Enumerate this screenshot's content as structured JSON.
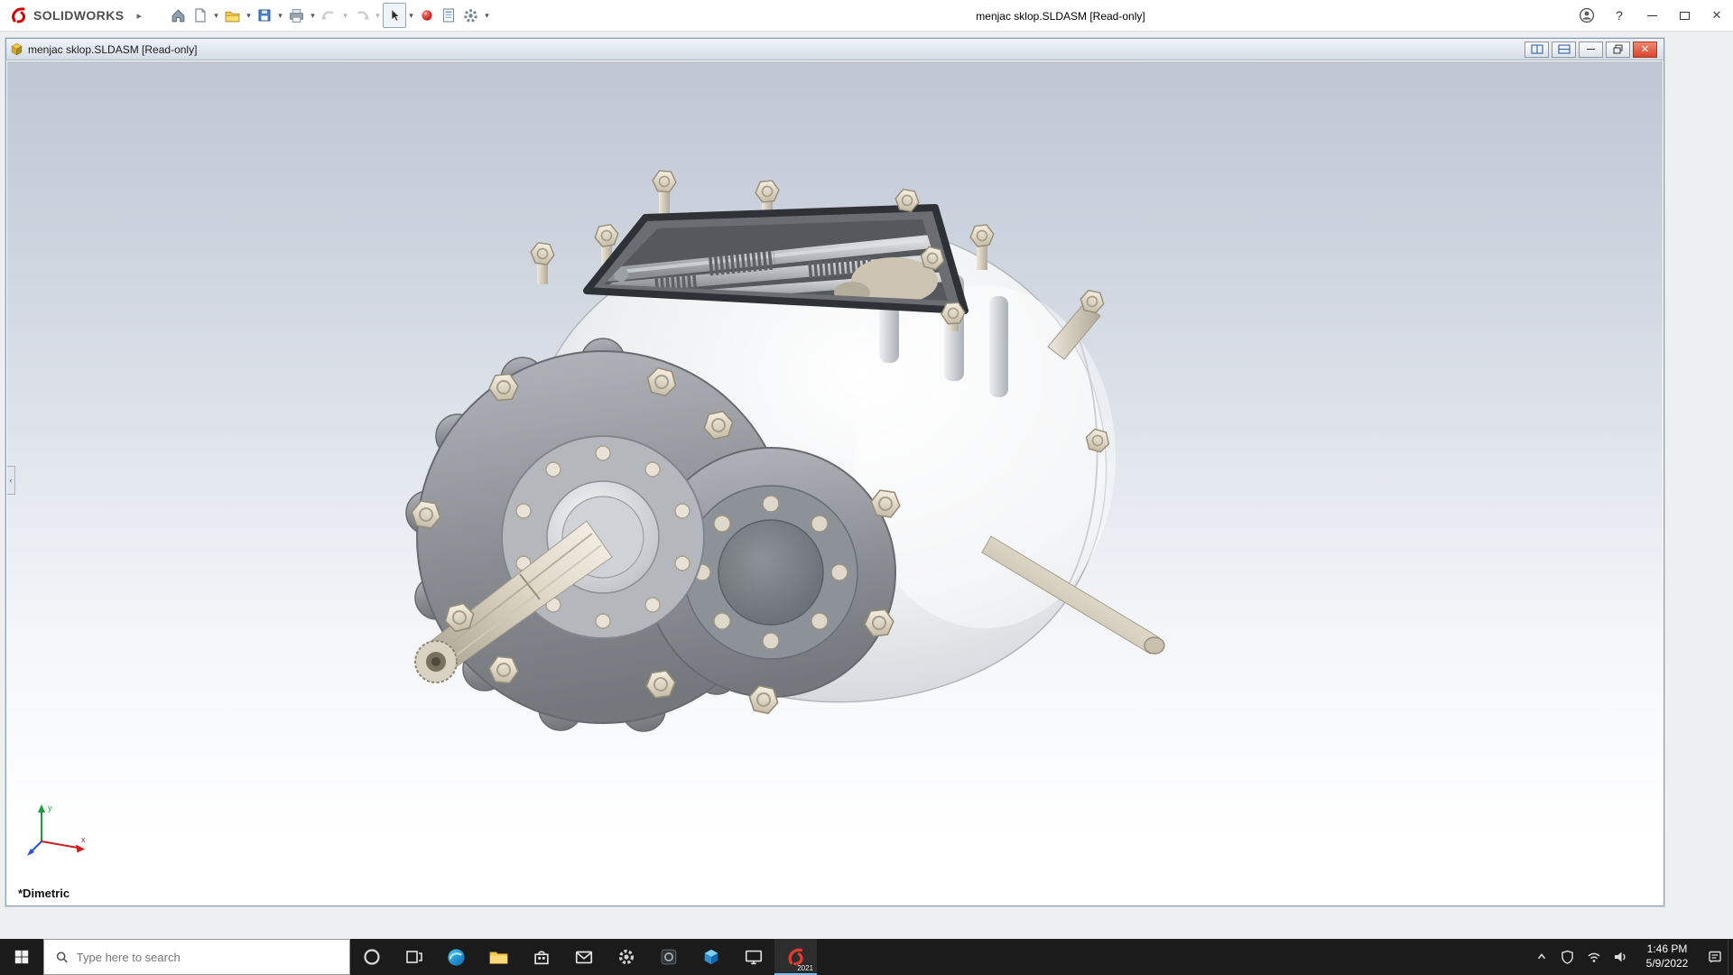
{
  "app": {
    "logo_text": "SOLIDWORKS",
    "title": "menjac sklop.SLDASM [Read-only]"
  },
  "icons": {
    "dropdown_arrow": "▾",
    "expand_arrow": "▸",
    "help_glyph": "?",
    "close_glyph": "✕",
    "panel_collapse_arrow": "‹"
  },
  "toolbar": {
    "items": [
      "home",
      "new-document",
      "open",
      "save",
      "print",
      "undo",
      "redo",
      "select",
      "3dexperience",
      "file-properties",
      "options"
    ]
  },
  "document_window": {
    "title": "menjac sklop.SLDASM [Read-only]",
    "orientation_label": "*Dimetric",
    "triad": {
      "x_label": "x",
      "y_label": "y"
    }
  },
  "taskbar": {
    "search_placeholder": "Type here to search",
    "app_icons": [
      "start",
      "cortana",
      "task-view",
      "edge",
      "file-explorer",
      "store",
      "mail",
      "settings",
      "screen-capture",
      "cad-cube",
      "display",
      "solidworks-2021"
    ],
    "solidworks_badge": "2021",
    "tray": {
      "time": "1:46 PM",
      "date": "5/9/2022",
      "icons": [
        "hidden-icons-chevron",
        "defender-shield",
        "network-wifi",
        "volume",
        "notifications"
      ]
    }
  },
  "colors": {
    "taskbar_bg": "#1b1b1b",
    "doc_close_button": "#d9442c",
    "logo_red": "#d40000",
    "viewport_gradient_top": "#bfc7d4",
    "viewport_gradient_bottom": "#ffffff"
  }
}
